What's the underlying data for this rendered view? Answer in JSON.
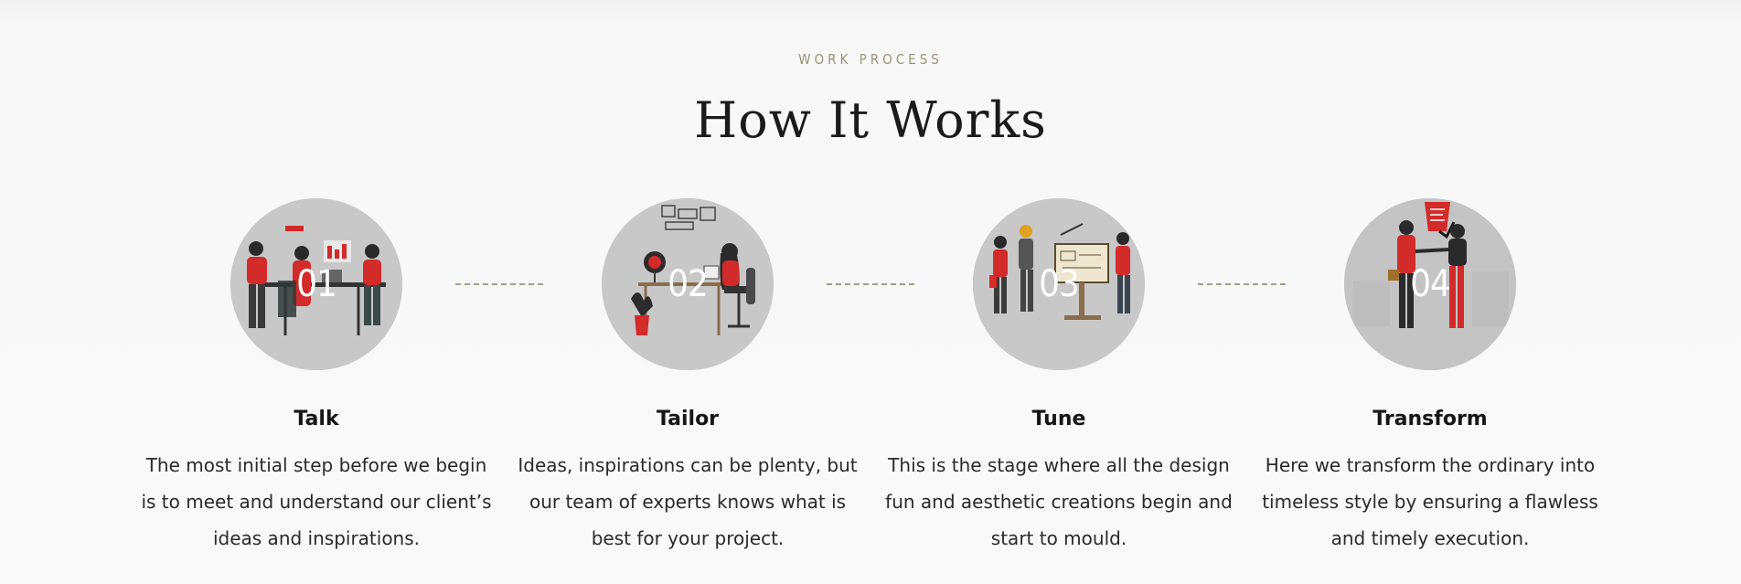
{
  "section": {
    "eyebrow": "WORK PROCESS",
    "title": "How It Works"
  },
  "steps": [
    {
      "number": "01",
      "title": "Talk",
      "text": "The most initial step before we begin is to meet and understand our client’s ideas and inspirations.",
      "icon": "meeting-illustration"
    },
    {
      "number": "02",
      "title": "Tailor",
      "text": "Ideas, inspirations can be plenty, but our team of experts knows what is best for your project.",
      "icon": "designer-desk-illustration"
    },
    {
      "number": "03",
      "title": "Tune",
      "text": "This is the stage where all the design fun and aesthetic creations begin and start to mould.",
      "icon": "workers-blueprint-illustration"
    },
    {
      "number": "04",
      "title": "Transform",
      "text": "Here we transform the ordinary into timeless style by ensuring a flawless and timely execution.",
      "icon": "handshake-illustration"
    }
  ],
  "colors": {
    "accent_red": "#d32a2a",
    "eyebrow_gold": "#9b9276",
    "circle_gray": "#c9c9c9",
    "dark_ink": "#1b1b1b"
  }
}
